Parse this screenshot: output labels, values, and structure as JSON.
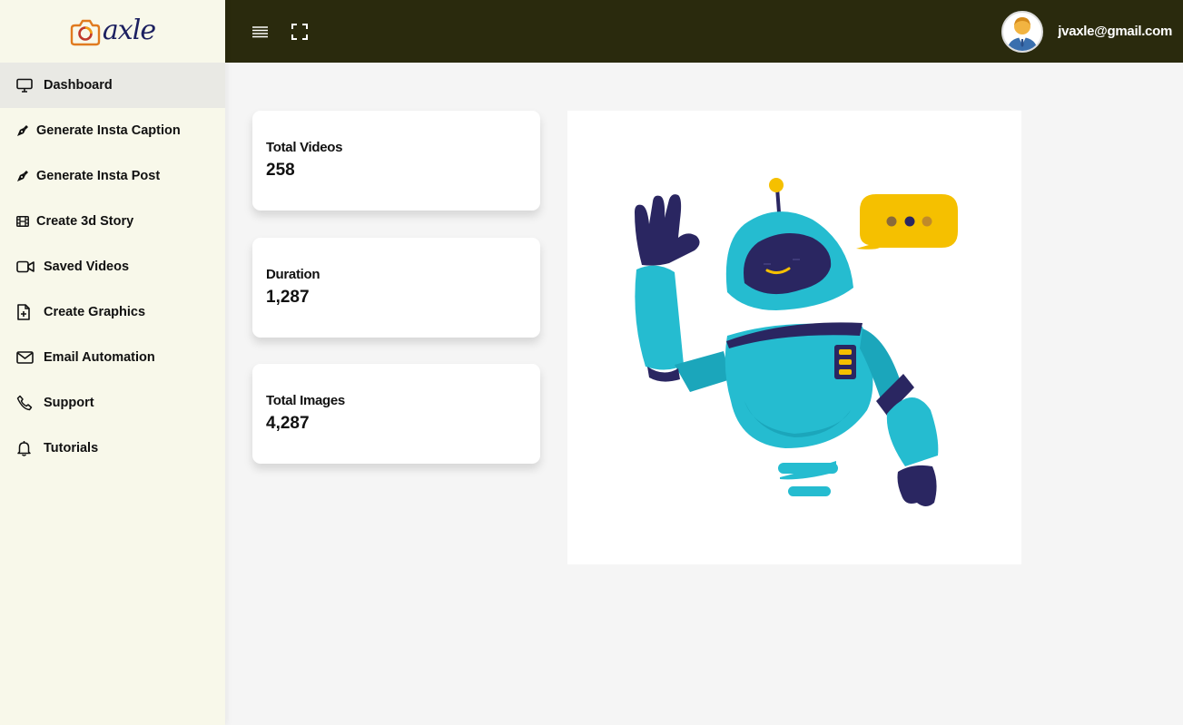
{
  "brand": {
    "logo_text": "axle"
  },
  "sidebar": {
    "items": [
      {
        "label": "Dashboard",
        "icon": "monitor-icon",
        "active": true
      },
      {
        "label": "Generate Insta Caption",
        "icon": "pen-nib-icon"
      },
      {
        "label": "Generate Insta Post",
        "icon": "pen-nib-icon"
      },
      {
        "label": "Create 3d Story",
        "icon": "film-icon"
      },
      {
        "label": "Saved Videos",
        "icon": "video-camera-icon"
      },
      {
        "label": "Create Graphics",
        "icon": "file-plus-icon"
      },
      {
        "label": "Email Automation",
        "icon": "envelope-icon"
      },
      {
        "label": "Support",
        "icon": "phone-icon"
      },
      {
        "label": "Tutorials",
        "icon": "bell-icon"
      }
    ]
  },
  "topbar": {
    "menu_icon": "hamburger-menu-icon",
    "expand_icon": "fullscreen-icon",
    "user_email": "jvaxle@gmail.com"
  },
  "stats": [
    {
      "label": "Total Videos",
      "value": "258"
    },
    {
      "label": "Duration",
      "value": "1,287"
    },
    {
      "label": "Total Images",
      "value": "4,287"
    }
  ],
  "illustration": {
    "subject": "waving-robot-illustration"
  },
  "colors": {
    "sidebar_bg": "#f8f8ea",
    "topbar_bg": "#2a2a0d",
    "content_bg": "#f5f5f5",
    "robot_body": "#25bcd0",
    "robot_dark": "#2a2661",
    "speech_bubble": "#f5c000"
  }
}
